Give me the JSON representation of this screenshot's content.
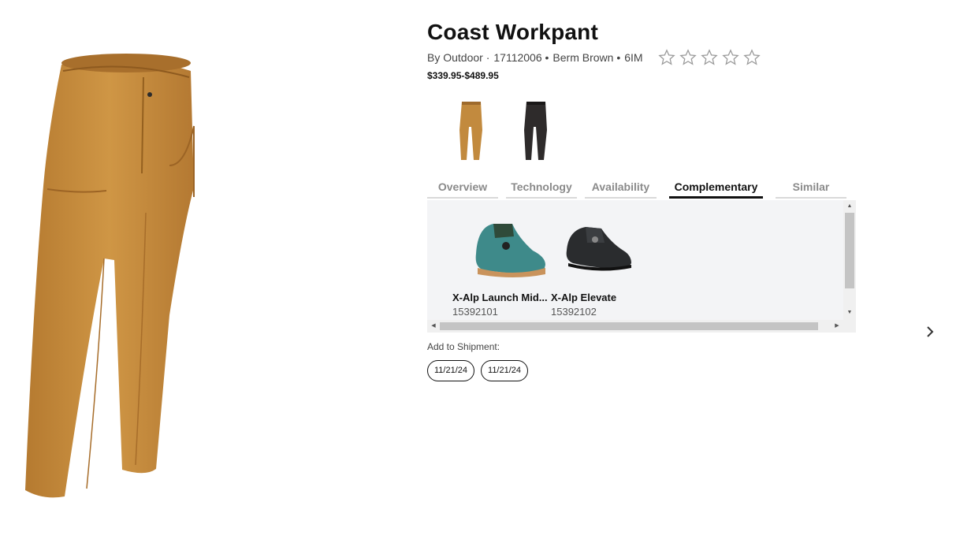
{
  "product": {
    "title": "Coast Workpant",
    "brand": "By Outdoor ·",
    "sku": "17112006 •",
    "color": "Berm Brown •",
    "code": "6IM",
    "price": "$339.95-$489.95",
    "rating": 0,
    "max_rating": 5
  },
  "swatches": [
    {
      "name": "Berm Brown",
      "color": "#c28a3e"
    },
    {
      "name": "Black",
      "color": "#2e2b2b"
    }
  ],
  "tabs": [
    {
      "label": "Overview",
      "active": false
    },
    {
      "label": "Technology",
      "active": false
    },
    {
      "label": "Availability",
      "active": false
    },
    {
      "label": "Complementary",
      "active": true
    },
    {
      "label": "Similar",
      "active": false
    }
  ],
  "complementary": [
    {
      "name": "X-Alp Launch Mid...",
      "sku": "15392101"
    },
    {
      "name": "X-Alp Elevate",
      "sku": "15392102"
    }
  ],
  "shipment": {
    "label": "Add to Shipment:",
    "dates": [
      "11/21/24",
      "11/21/24"
    ]
  },
  "colors": {
    "pant": "#c28a3e",
    "accent": "#111111"
  }
}
